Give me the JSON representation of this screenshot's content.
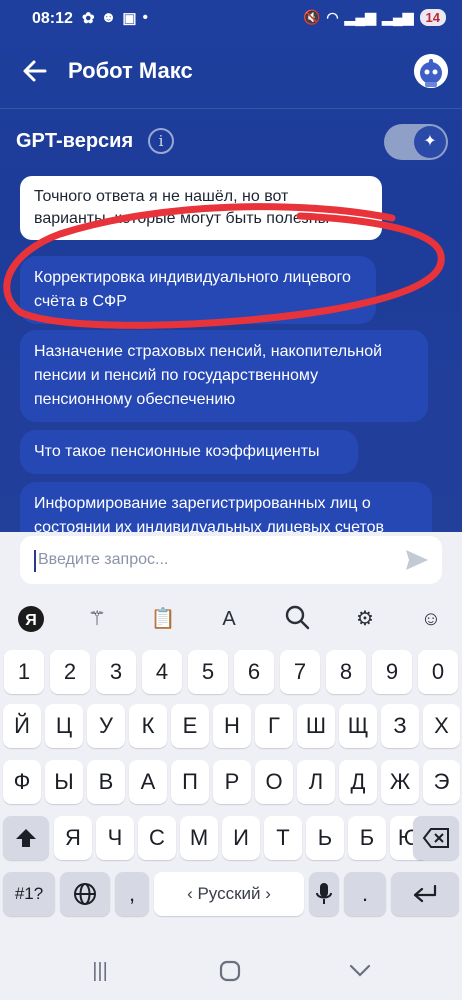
{
  "status_bar": {
    "time": "08:12",
    "battery": "14"
  },
  "header": {
    "title": "Робот Макс"
  },
  "gpt": {
    "label": "GPT-версия",
    "enabled": true
  },
  "chat": {
    "bot_message": "Точного ответа я не нашёл, но вот варианты, которые могут быть полезны",
    "options": [
      "Корректировка индивидуального лицевого счёта в СФР",
      "Назначение страховых пенсий, накопительной пенсии и пенсий по государственному пенсионному обеспечению",
      "Что такое пенсионные коэффициенты",
      "Информирование зарегистрированных лиц о состоянии их индивидуальных лицевых счетов"
    ]
  },
  "input": {
    "placeholder": "Введите запрос..."
  },
  "keyboard": {
    "numbers": [
      "1",
      "2",
      "3",
      "4",
      "5",
      "6",
      "7",
      "8",
      "9",
      "0"
    ],
    "row1": [
      "Й",
      "Ц",
      "У",
      "К",
      "Е",
      "Н",
      "Г",
      "Ш",
      "Щ",
      "З",
      "Х"
    ],
    "row2": [
      "Ф",
      "Ы",
      "В",
      "А",
      "П",
      "Р",
      "О",
      "Л",
      "Д",
      "Ж",
      "Э"
    ],
    "row3": [
      "Я",
      "Ч",
      "С",
      "М",
      "И",
      "Т",
      "Ь",
      "Б",
      "Ю"
    ],
    "symbols_key": "#1?",
    "comma": ",",
    "period": ".",
    "space_label": "‹ Русский ›",
    "yandex_key": "Я"
  },
  "colors": {
    "accent": "#1f3f9e",
    "option_bg": "#2548b5",
    "highlight_stroke": "#e8333b"
  }
}
